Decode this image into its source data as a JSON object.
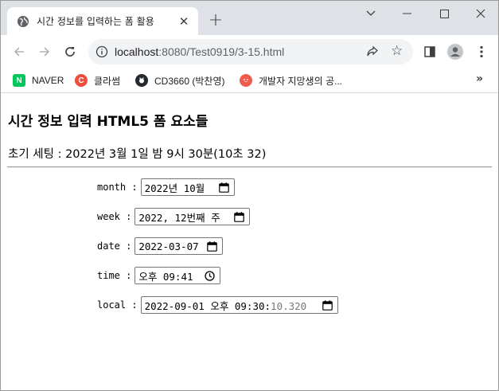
{
  "browser": {
    "tab_title": "시간 정보를 입력하는 폼 활용",
    "url_host": "localhost",
    "url_path": ":8080/Test0919/3-15.html"
  },
  "bookmarks": [
    {
      "label": "NAVER",
      "icon": "naver-icon",
      "color": "#03c75a"
    },
    {
      "label": "클라썸",
      "icon": "classum-icon",
      "color": "#f04e3e"
    },
    {
      "label": "CD3660 (박찬영)",
      "icon": "github-icon",
      "color": "#24292f"
    },
    {
      "label": "개발자 지망생의 공...",
      "icon": "blog-icon",
      "color": "#ef5b4c"
    }
  ],
  "page": {
    "title": "시간 정보 입력 HTML5 폼 요소들",
    "subtitle": "초기 세팅 : 2022년 3월 1일 밤 9시 30분(10초 32)"
  },
  "form": {
    "month": {
      "label": "month :",
      "value": "2022년 10월"
    },
    "week": {
      "label": "week :",
      "value": "2022, 12번째 주"
    },
    "date": {
      "label": "date :",
      "value": "2022-03-07"
    },
    "time": {
      "label": "time :",
      "value": "오후 09:41"
    },
    "local": {
      "label": "local :",
      "value": "2022-09-01 오후 09:30:",
      "value_dim": "10.320"
    }
  }
}
